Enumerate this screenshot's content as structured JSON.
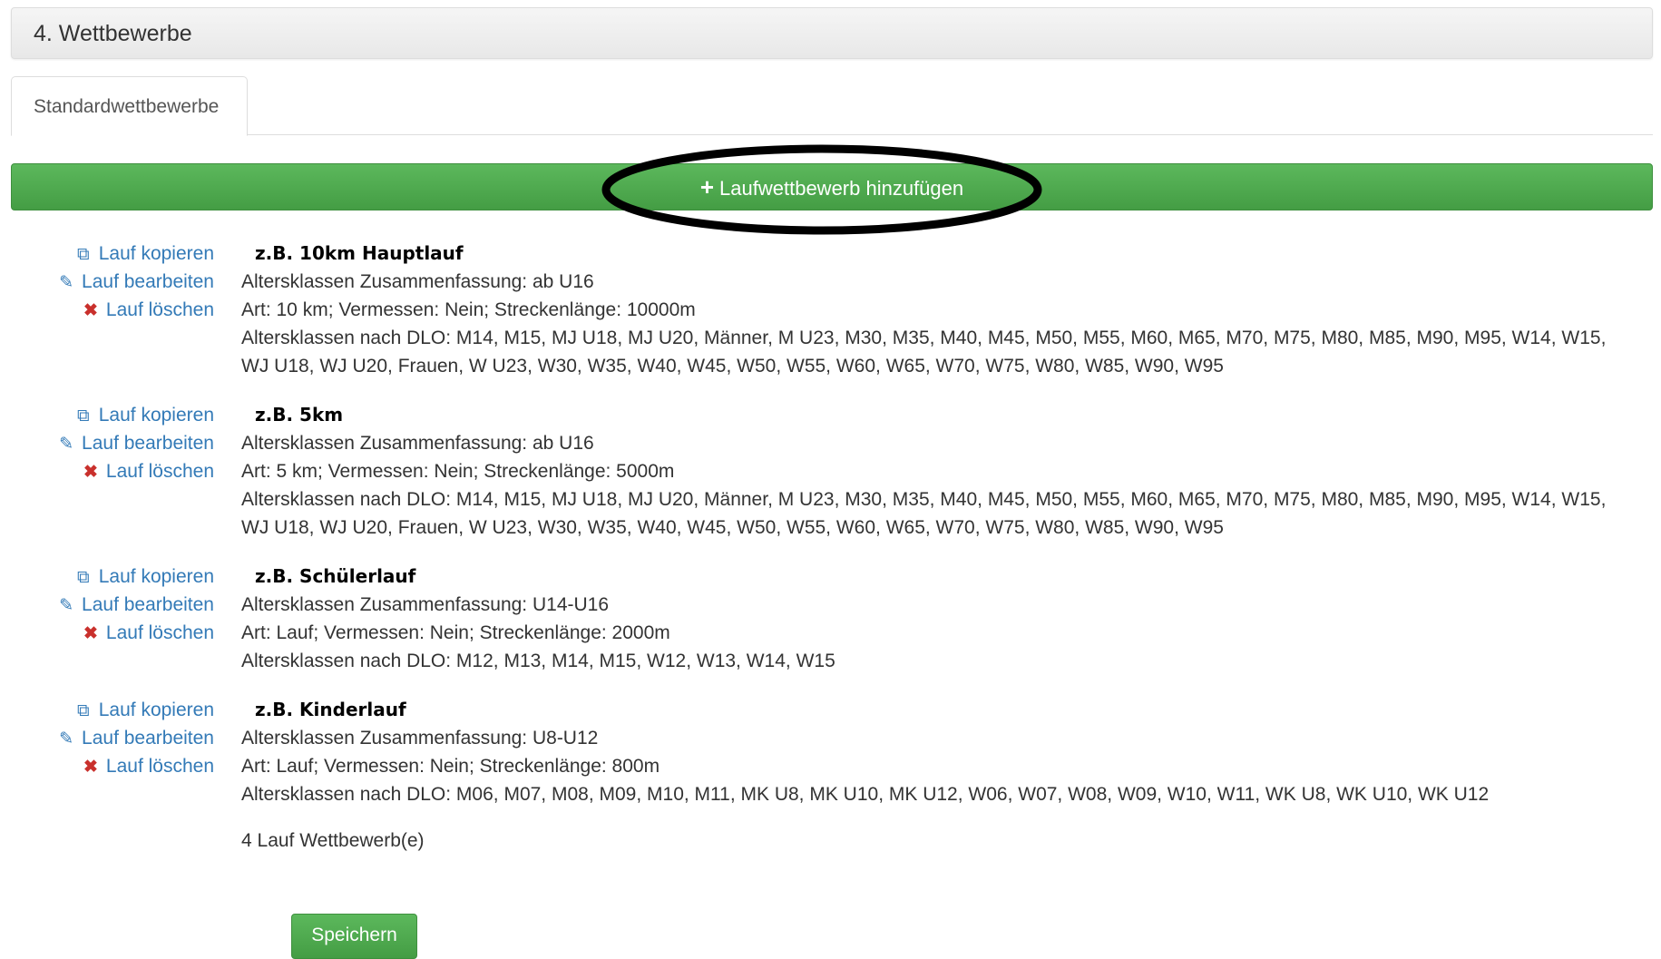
{
  "section": {
    "title": "4. Wettbewerbe"
  },
  "tabs": [
    {
      "label": "Standardwettbewerbe"
    }
  ],
  "add_button": {
    "icon": "plus-icon",
    "label": "Laufwettbewerb hinzufügen"
  },
  "actions": {
    "copy": "Lauf kopieren",
    "edit": "Lauf bearbeiten",
    "delete": "Lauf löschen"
  },
  "races": [
    {
      "title": "z.B. 10km Hauptlauf",
      "summary": "Altersklassen Zusammenfassung: ab U16",
      "info": "Art: 10 km; Vermessen: Nein; Streckenlänge: 10000m",
      "classes_1": "Altersklassen nach DLO: M14, M15, MJ U18, MJ U20, Männer, M U23, M30, M35, M40, M45, M50, M55, M60, M65, M70, M75, M80, M85, M90, M95, W14, W15,",
      "classes_2": "WJ U18, WJ U20, Frauen, W U23, W30, W35, W40, W45, W50, W55, W60, W65, W70, W75, W80, W85, W90, W95"
    },
    {
      "title": "z.B. 5km",
      "summary": "Altersklassen Zusammenfassung: ab U16",
      "info": "Art: 5 km; Vermessen: Nein; Streckenlänge: 5000m",
      "classes_1": "Altersklassen nach DLO: M14, M15, MJ U18, MJ U20, Männer, M U23, M30, M35, M40, M45, M50, M55, M60, M65, M70, M75, M80, M85, M90, M95, W14, W15,",
      "classes_2": "WJ U18, WJ U20, Frauen, W U23, W30, W35, W40, W45, W50, W55, W60, W65, W70, W75, W80, W85, W90, W95"
    },
    {
      "title": "z.B. Schülerlauf",
      "summary": "Altersklassen Zusammenfassung: U14-U16",
      "info": "Art: Lauf; Vermessen: Nein; Streckenlänge: 2000m",
      "classes_1": "Altersklassen nach DLO: M12, M13, M14, M15, W12, W13, W14, W15"
    },
    {
      "title": "z.B. Kinderlauf",
      "summary": "Altersklassen Zusammenfassung: U8-U12",
      "info": "Art: Lauf; Vermessen: Nein; Streckenlänge: 800m",
      "classes_1": "Altersklassen nach DLO: M06, M07, M08, M09, M10, M11, MK U8, MK U10, MK U12, W06, W07, W08, W09, W10, W11, WK U8, WK U10, WK U12"
    }
  ],
  "count_text": "4 Lauf Wettbewerb(e)",
  "save_button": {
    "label": "Speichern"
  },
  "colors": {
    "link": "#337ab7",
    "success": "#5cb85c",
    "danger": "#c9302c"
  }
}
